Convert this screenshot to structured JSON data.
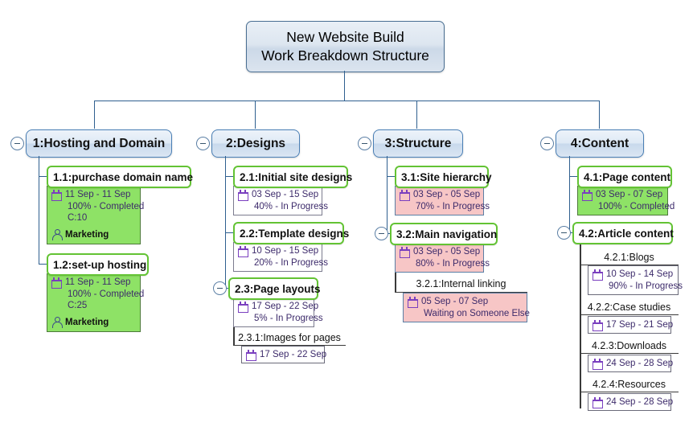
{
  "title": {
    "line1": "New Website Build",
    "line2": "Work Breakdown Structure"
  },
  "icons": {
    "collapse": "minus-circle-icon",
    "calendar": "calendar-icon",
    "person": "person-icon"
  },
  "colors": {
    "root_fill": "#dde6f0",
    "phase_fill": "#dee9f5",
    "phase_border": "#4a7fb5",
    "task_border_green": "#63c334",
    "card_completed": "#8ee266",
    "card_at_risk": "#f7c6c6",
    "card_plain": "#ffffff",
    "connector": "#2f5f8f",
    "connector_sub": "#3a3a3a",
    "date_text": "#3d2b6b"
  },
  "phases": [
    {
      "label": "1:Hosting and Domain",
      "collapsed": false,
      "tasks": [
        {
          "label": "1.1:purchase domain name",
          "dates": "11 Sep - 11 Sep",
          "status": "100% - Completed",
          "cost": "C:10",
          "owner": "Marketing",
          "card_style": "green"
        },
        {
          "label": "1.2:set-up hosting",
          "dates": "11 Sep - 11 Sep",
          "status": "100% - Completed",
          "cost": "C:25",
          "owner": "Marketing",
          "card_style": "green"
        }
      ]
    },
    {
      "label": "2:Designs",
      "collapsed": false,
      "tasks": [
        {
          "label": "2.1:Initial site designs",
          "dates": "03 Sep - 15 Sep",
          "status": "40% - In Progress",
          "card_style": "white"
        },
        {
          "label": "2.2:Template designs",
          "dates": "10 Sep - 15 Sep",
          "status": "20% - In Progress",
          "card_style": "white"
        },
        {
          "label": "2.3:Page layouts",
          "dates": "17 Sep - 22 Sep",
          "status": "5% - In Progress",
          "card_style": "white",
          "has_toggle": true,
          "subtasks": [
            {
              "label": "2.3.1:Images for pages",
              "dates": "17 Sep - 22 Sep",
              "status": "",
              "card_style": "plain"
            }
          ]
        }
      ]
    },
    {
      "label": "3:Structure",
      "collapsed": false,
      "tasks": [
        {
          "label": "3.1:Site hierarchy",
          "dates": "03 Sep - 05 Sep",
          "status": "70% - In Progress",
          "card_style": "pink"
        },
        {
          "label": "3.2:Main navigation",
          "dates": "03 Sep - 05 Sep",
          "status": "80% - In Progress",
          "card_style": "pink",
          "has_toggle": true,
          "subtasks": [
            {
              "label": "3.2.1:Internal linking",
              "dates": "05 Sep - 07 Sep",
              "status": "Waiting on Someone Else",
              "card_style": "pink"
            }
          ]
        }
      ]
    },
    {
      "label": "4:Content",
      "collapsed": false,
      "tasks": [
        {
          "label": "4.1:Page content",
          "dates": "03 Sep - 07 Sep",
          "status": "100% - Completed",
          "card_style": "green"
        },
        {
          "label": "4.2:Article content",
          "has_toggle": true,
          "subtasks": [
            {
              "label": "4.2.1:Blogs",
              "dates": "10 Sep - 14 Sep",
              "status": "90% - In Progress",
              "card_style": "plain"
            },
            {
              "label": "4.2.2:Case studies",
              "dates": "17 Sep - 21 Sep",
              "status": "",
              "card_style": "plain"
            },
            {
              "label": "4.2.3:Downloads",
              "dates": "24 Sep - 28 Sep",
              "status": "",
              "card_style": "plain"
            },
            {
              "label": "4.2.4:Resources",
              "dates": "24 Sep - 28 Sep",
              "status": "",
              "card_style": "plain"
            }
          ]
        }
      ]
    }
  ]
}
